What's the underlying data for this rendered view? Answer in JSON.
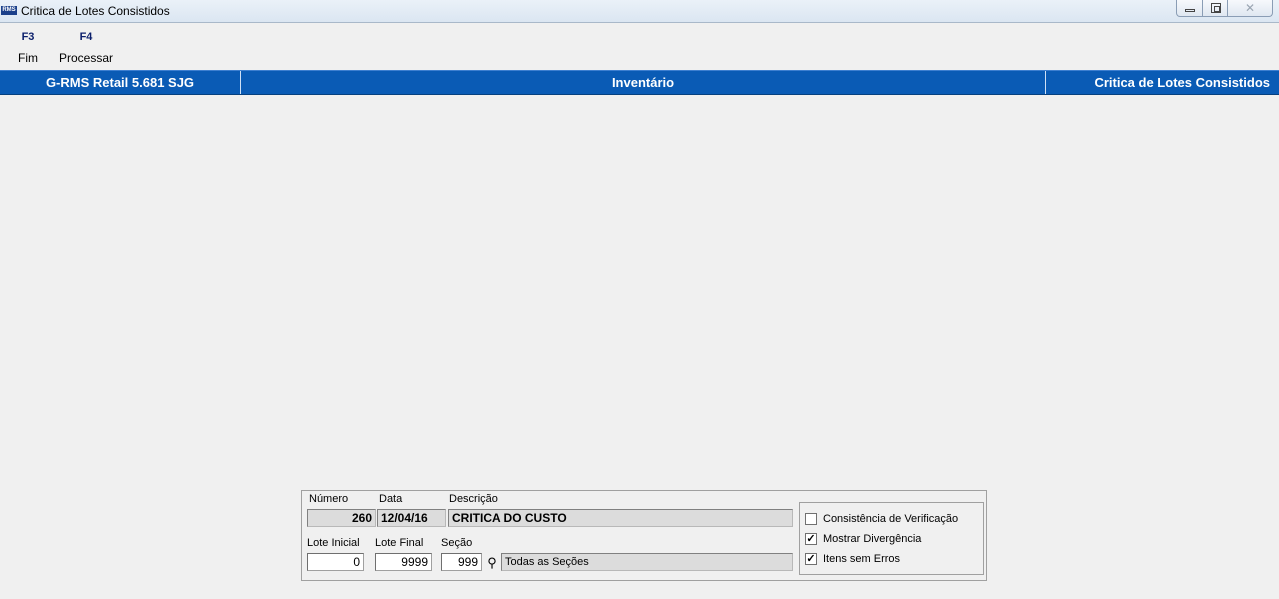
{
  "window": {
    "title": "Critica de Lotes Consistidos",
    "app_icon_label": "RMS",
    "close_glyph": "✕"
  },
  "toolbar": {
    "items": [
      {
        "key": "F3",
        "label": "Fim"
      },
      {
        "key": "F4",
        "label": "Processar"
      }
    ]
  },
  "header": {
    "left": "G-RMS Retail 5.681 SJG",
    "center": "Inventário",
    "right": "Critica de Lotes Consistidos"
  },
  "form": {
    "numero_label": "Número",
    "numero_value": "260",
    "data_label": "Data",
    "data_value": "12/04/16",
    "descricao_label": "Descrição",
    "descricao_value": "CRITICA DO CUSTO",
    "lote_inicial_label": "Lote Inicial",
    "lote_inicial_value": "0",
    "lote_final_label": "Lote Final",
    "lote_final_value": "9999",
    "secao_label": "Seção",
    "secao_value": "999",
    "secao_desc": "Todas as Seções",
    "search_icon_glyph": "⚲"
  },
  "options": [
    {
      "label": "Consistência de Verificação",
      "checked": false
    },
    {
      "label": "Mostrar Divergência",
      "checked": true
    },
    {
      "label": "Itens sem Erros",
      "checked": true
    }
  ],
  "colors": {
    "accent": "#0a5bb5",
    "background": "#f0f0f0"
  }
}
